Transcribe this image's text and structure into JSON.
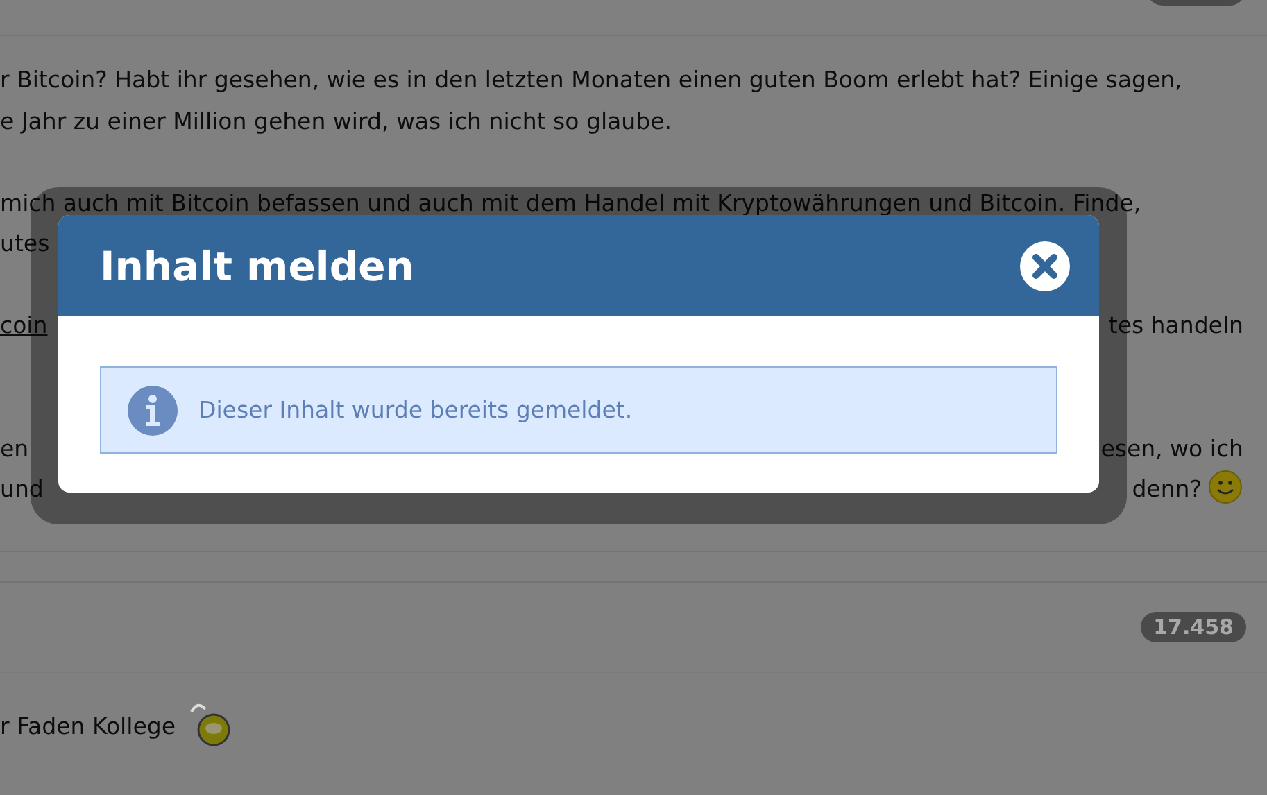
{
  "post": {
    "paragraphs": [
      {
        "lines": [
          {
            "left": [
              {
                "kind": "text",
                "text": "r Bitcoin? Habt ihr gesehen, wie es in den letzten Monaten einen guten Boom erlebt hat? Einige sagen,"
              }
            ]
          },
          {
            "left": [
              {
                "kind": "text",
                "text": "e Jahr zu einer Million gehen wird, was ich nicht so glaube."
              }
            ]
          }
        ]
      },
      {
        "lines": [
          {
            "left": [
              {
                "kind": "text",
                "text": "mich auch mit Bitcoin befassen und auch mit dem Handel mit Kryptowährungen und Bitcoin. Finde,"
              }
            ]
          },
          {
            "left": [
              {
                "kind": "text",
                "text": "utes"
              }
            ]
          }
        ]
      },
      {
        "lines": [
          {
            "left": [
              {
                "kind": "link",
                "text": "coin"
              }
            ],
            "right": [
              {
                "kind": "text",
                "text": "tes handeln"
              }
            ]
          }
        ]
      },
      {
        "lines": [
          {
            "left": [
              {
                "kind": "text",
                "text": "en"
              }
            ],
            "right": [
              {
                "kind": "text",
                "text": "esen, wo ich"
              }
            ]
          },
          {
            "left": [
              {
                "kind": "text",
                "text": "und"
              }
            ],
            "right": [
              {
                "kind": "text",
                "text": "denn?"
              },
              {
                "kind": "smiley"
              }
            ]
          }
        ]
      }
    ]
  },
  "reply": {
    "badge": "17.458",
    "text": "r Faden Kollege"
  },
  "dialog": {
    "title": "Inhalt melden",
    "message": "Dieser Inhalt wurde bereits gemeldet."
  }
}
